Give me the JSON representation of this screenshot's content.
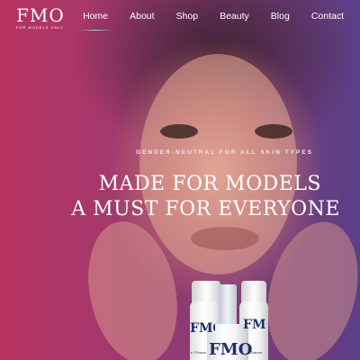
{
  "brand": {
    "name": "FMO",
    "tagline": "FOR MODELS ONLY"
  },
  "nav": {
    "items": [
      {
        "label": "Home",
        "active": true
      },
      {
        "label": "About"
      },
      {
        "label": "Shop"
      },
      {
        "label": "Beauty"
      },
      {
        "label": "Blog"
      },
      {
        "label": "Contact"
      }
    ]
  },
  "hero": {
    "eyebrow": "GENDER-NEUTRAL FOR ALL SKIN TYPES",
    "headline_line1": "MADE FOR MODELS",
    "headline_line2": "A MUST FOR EVERYONE"
  },
  "products": {
    "left_label": "FMO",
    "center_label": "FMO",
    "right_label": "FMO",
    "left_small": "r Cleans",
    "right_small": "Tanwa"
  },
  "colors": {
    "bg_left": "#b8325f",
    "bg_right": "#5b3f88",
    "nav_active_underline": "#9bd3f0",
    "bottle_label": "#1f2f6b"
  }
}
